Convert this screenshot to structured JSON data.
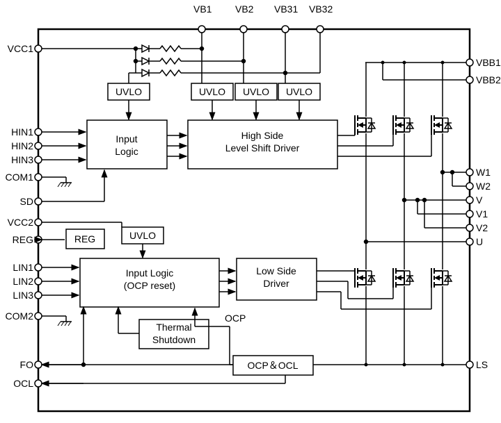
{
  "pins": {
    "top": {
      "vb1": "VB1",
      "vb2": "VB2",
      "vb31": "VB31",
      "vb32": "VB32"
    },
    "left": {
      "vcc1": "VCC1",
      "hin1": "HIN1",
      "hin2": "HIN2",
      "hin3": "HIN3",
      "com1": "COM1",
      "sd": "SD",
      "vcc2": "VCC2",
      "reg": "REG",
      "lin1": "LIN1",
      "lin2": "LIN2",
      "lin3": "LIN3",
      "com2": "COM2",
      "fo": "FO",
      "ocl": "OCL"
    },
    "right": {
      "vbb1": "VBB1",
      "vbb2": "VBB2",
      "w1": "W1",
      "w2": "W2",
      "v": "V",
      "v1": "V1",
      "v2": "V2",
      "u": "U",
      "ls": "LS"
    }
  },
  "blocks": {
    "uvlo": "UVLO",
    "input_logic": "Input\nLogic",
    "high_side": "High Side\nLevel Shift Driver",
    "reg": "REG",
    "input_logic_ocp": "Input Logic\n(OCP reset)",
    "low_side": "Low Side\nDriver",
    "thermal": "Thermal\nShutdown",
    "ocp_ocl": "OCP＆OCL",
    "ocp_small": "OCP"
  }
}
